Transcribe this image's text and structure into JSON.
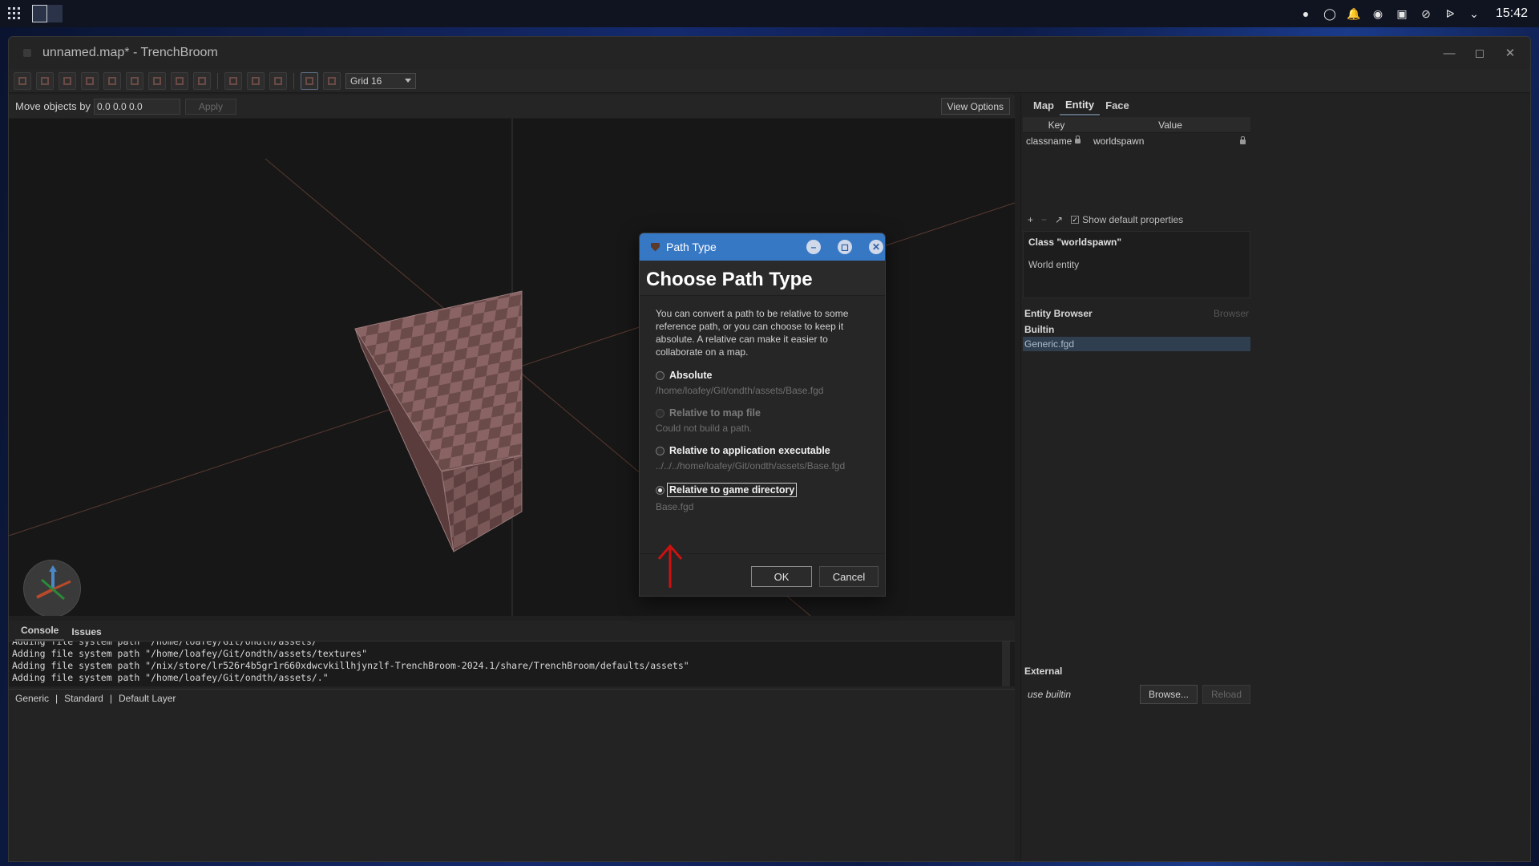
{
  "desktop": {
    "clock": "15:42"
  },
  "window": {
    "title": "unnamed.map* - TrenchBroom"
  },
  "toolbar": {
    "grid_select": "Grid 16"
  },
  "movebar": {
    "label": "Move objects by",
    "value": "0.0 0.0 0.0",
    "apply_label": "Apply",
    "view_options_label": "View Options"
  },
  "console": {
    "tabs": [
      "Console",
      "Issues"
    ],
    "lines": [
      "Adding file system path \"/home/loafey/Git/ondth/assets/\"",
      "Adding file system path \"/home/loafey/Git/ondth/assets/textures\"",
      "Adding file system path \"/nix/store/lr526r4b5gr1r660xdwcvkillhjynzlf-TrenchBroom-2024.1/share/TrenchBroom/defaults/assets\"",
      "Adding file system path \"/home/loafey/Git/ondth/assets/.\""
    ]
  },
  "statusbar": {
    "items": [
      "Generic",
      "|",
      "Standard",
      "|",
      "Default Layer"
    ]
  },
  "inspector": {
    "tabs": [
      "Map",
      "Entity",
      "Face"
    ],
    "active_tab": "Entity",
    "columns": {
      "key": "Key",
      "value": "Value"
    },
    "rows": [
      {
        "key": "classname",
        "value": "worldspawn"
      }
    ],
    "show_default_label": "Show default properties",
    "class_title": "Class \"worldspawn\"",
    "class_desc": "World entity",
    "entity_browser": {
      "title": "Entity Browser",
      "browser_label": "Browser",
      "section": "Builtin",
      "item": "Generic.fgd"
    },
    "external": {
      "title": "External",
      "use_label": "use builtin",
      "browse_label": "Browse...",
      "reload_label": "Reload"
    }
  },
  "dialog": {
    "title": "Path Type",
    "heading": "Choose Path Type",
    "description": "You can convert a path to be relative to some reference path, or you can choose to keep it absolute. A relative can make it easier to collaborate on a map.",
    "options": [
      {
        "label": "Absolute",
        "path": "/home/loafey/Git/ondth/assets/Base.fgd"
      },
      {
        "label": "Relative to map file",
        "path": "Could not build a path."
      },
      {
        "label": "Relative to application executable",
        "path": "../../../home/loafey/Git/ondth/assets/Base.fgd"
      },
      {
        "label": "Relative to game directory",
        "path": "Base.fgd"
      }
    ],
    "ok_label": "OK",
    "cancel_label": "Cancel"
  },
  "colors": {
    "dialog_titlebar": "#3778c5",
    "annotation_arrow": "#cc1111",
    "brush_face": "#6b4a4a"
  }
}
